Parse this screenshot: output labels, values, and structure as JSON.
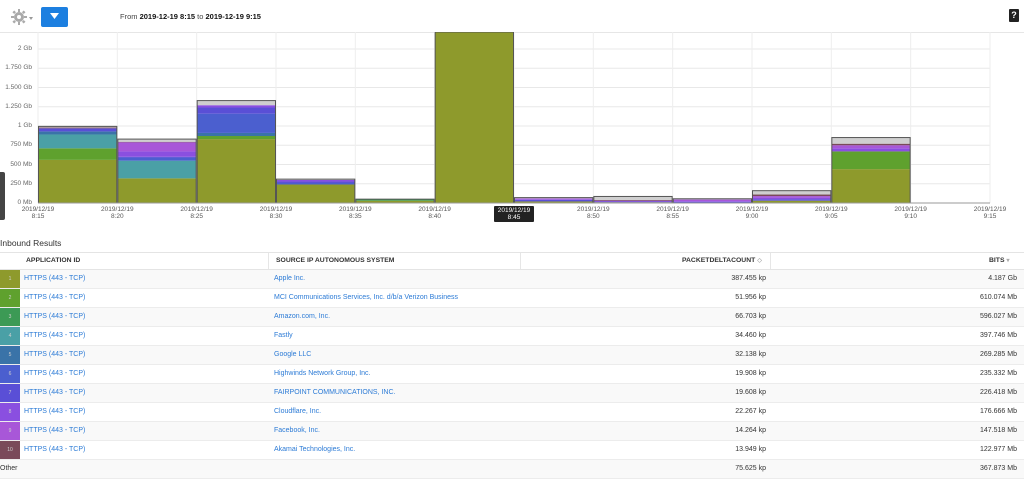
{
  "toolbar": {
    "gear_icon": "gear-icon",
    "dropdown_icon": "chevron-down-icon",
    "range_from_label": "From",
    "range_from": "2019-12-19 8:15",
    "range_to_label": "to",
    "range_to": "2019-12-19 9:15",
    "help_label": "?"
  },
  "chart_data": {
    "type": "bar",
    "stacked": true,
    "y_ticks": [
      "2 Gb",
      "1.750 Gb",
      "1.500 Gb",
      "1.250 Gb",
      "1 Gb",
      "750 Mb",
      "500 Mb",
      "250 Mb",
      "0 Mb"
    ],
    "ylim": [
      0,
      2000
    ],
    "y_unit": "Mb",
    "x_ticks": [
      [
        "2019/12/19",
        "8:15"
      ],
      [
        "2019/12/19",
        "8:20"
      ],
      [
        "2019/12/19",
        "8:25"
      ],
      [
        "2019/12/19",
        "8:30"
      ],
      [
        "2019/12/19",
        "8:35"
      ],
      [
        "2019/12/19",
        "8:40"
      ],
      [
        "2019/12/19",
        "8:45"
      ],
      [
        "2019/12/19",
        "8:50"
      ],
      [
        "2019/12/19",
        "8:55"
      ],
      [
        "2019/12/19",
        "9:00"
      ],
      [
        "2019/12/19",
        "9:05"
      ],
      [
        "2019/12/19",
        "9:10"
      ],
      [
        "2019/12/19",
        "9:15"
      ]
    ],
    "highlighted_tick": 6,
    "grid": true,
    "series_colors": [
      "#8e9a2c",
      "#5fa12e",
      "#3c9a55",
      "#4aa0a6",
      "#3a73a8",
      "#4b5fcf",
      "#5a4fd6",
      "#8a4fe0",
      "#a857d8",
      "#7a4a5a",
      "#cfcfcf"
    ],
    "stacks": [
      [
        560,
        150,
        0,
        180,
        40,
        0,
        40,
        0,
        0,
        10,
        15
      ],
      [
        320,
        0,
        0,
        230,
        0,
        40,
        10,
        70,
        120,
        5,
        35
      ],
      [
        830,
        40,
        0,
        0,
        40,
        250,
        80,
        30,
        0,
        0,
        60
      ],
      [
        240,
        0,
        0,
        0,
        0,
        20,
        20,
        20,
        0,
        0,
        10
      ],
      [
        30,
        0,
        20,
        0,
        0,
        0,
        0,
        0,
        0,
        0,
        0
      ],
      [
        2220,
        0,
        25,
        0,
        0,
        0,
        0,
        0,
        0,
        0,
        0
      ],
      [
        20,
        0,
        0,
        0,
        0,
        0,
        20,
        10,
        10,
        0,
        10
      ],
      [
        10,
        0,
        0,
        0,
        0,
        0,
        10,
        0,
        10,
        10,
        45
      ],
      [
        5,
        0,
        0,
        0,
        0,
        0,
        10,
        10,
        20,
        0,
        10
      ],
      [
        30,
        0,
        0,
        0,
        0,
        0,
        20,
        20,
        20,
        20,
        50
      ],
      [
        440,
        230,
        0,
        0,
        0,
        0,
        0,
        40,
        40,
        20,
        80
      ]
    ]
  },
  "results": {
    "title": "Inbound Results",
    "headers": {
      "application": "APPLICATION ID",
      "source": "SOURCE IP AUTONOMOUS SYSTEM",
      "packets": "PACKETDELTACOUNT",
      "bits": "BITS"
    },
    "rows": [
      {
        "idx": "1",
        "color": "#8e9a2c",
        "app": "HTTPS (443 - TCP)",
        "source": "Apple Inc.",
        "packets": "387.455 kp",
        "bits": "4.187 Gb"
      },
      {
        "idx": "2",
        "color": "#5fa12e",
        "app": "HTTPS (443 - TCP)",
        "source": "MCI Communications Services, Inc. d/b/a Verizon Business",
        "packets": "51.956 kp",
        "bits": "610.074 Mb"
      },
      {
        "idx": "3",
        "color": "#3c9a55",
        "app": "HTTPS (443 - TCP)",
        "source": "Amazon.com, Inc.",
        "packets": "66.703 kp",
        "bits": "596.027 Mb"
      },
      {
        "idx": "4",
        "color": "#4aa0a6",
        "app": "HTTPS (443 - TCP)",
        "source": "Fastly",
        "packets": "34.460 kp",
        "bits": "397.746 Mb"
      },
      {
        "idx": "5",
        "color": "#3a73a8",
        "app": "HTTPS (443 - TCP)",
        "source": "Google LLC",
        "packets": "32.138 kp",
        "bits": "269.285 Mb"
      },
      {
        "idx": "6",
        "color": "#4b5fcf",
        "app": "HTTPS (443 - TCP)",
        "source": "Highwinds Network Group, Inc.",
        "packets": "19.908 kp",
        "bits": "235.332 Mb"
      },
      {
        "idx": "7",
        "color": "#5a4fd6",
        "app": "HTTPS (443 - TCP)",
        "source": "FAIRPOINT COMMUNICATIONS, INC.",
        "packets": "19.608 kp",
        "bits": "226.418 Mb"
      },
      {
        "idx": "8",
        "color": "#8a4fe0",
        "app": "HTTPS (443 - TCP)",
        "source": "Cloudflare, Inc.",
        "packets": "22.267 kp",
        "bits": "176.666 Mb"
      },
      {
        "idx": "9",
        "color": "#a857d8",
        "app": "HTTPS (443 - TCP)",
        "source": "Facebook, Inc.",
        "packets": "14.264 kp",
        "bits": "147.518 Mb"
      },
      {
        "idx": "10",
        "color": "#7a4a5a",
        "app": "HTTPS (443 - TCP)",
        "source": "Akamai Technologies, Inc.",
        "packets": "13.949 kp",
        "bits": "122.977 Mb"
      }
    ],
    "other": {
      "label": "Other",
      "packets": "75.625 kp",
      "bits": "367.873 Mb"
    }
  }
}
